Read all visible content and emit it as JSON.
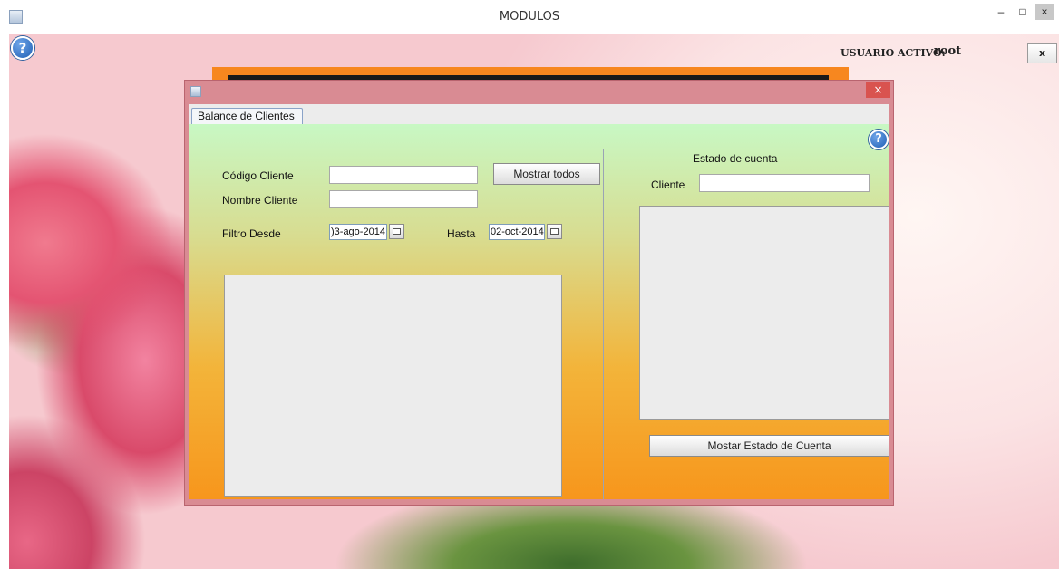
{
  "window": {
    "title": "MODULOS",
    "minimize": "–",
    "maximize": "□",
    "close": "×"
  },
  "header": {
    "help_glyph": "?",
    "user_label": "USUARIO ACTIVO:",
    "user_name": "root",
    "logout_label": "x"
  },
  "frame": {
    "close": "×",
    "tab_label": "Balance de Clientes"
  },
  "left_panel": {
    "codigo_label": "Código Cliente",
    "codigo_value": "",
    "nombre_label": "Nombre Cliente",
    "nombre_value": "",
    "mostrar_button": "Mostrar todos",
    "filtro_label": "Filtro Desde",
    "desde_value": ")3-ago-2014",
    "hasta_label": "Hasta",
    "hasta_value": "02-oct-2014"
  },
  "right_panel": {
    "help_glyph": "?",
    "title": "Estado de cuenta",
    "cliente_label": "Cliente",
    "cliente_value": "",
    "estado_button": "Mostar Estado de Cuenta"
  },
  "icons": {
    "app": "java-cup-icon",
    "help": "help-icon",
    "calendar": "calendar-icon"
  },
  "colors": {
    "frame_border": "#d98b93",
    "banner": "#f7871f",
    "gradient_top": "#c8f8c4",
    "gradient_bottom": "#f7961c"
  }
}
